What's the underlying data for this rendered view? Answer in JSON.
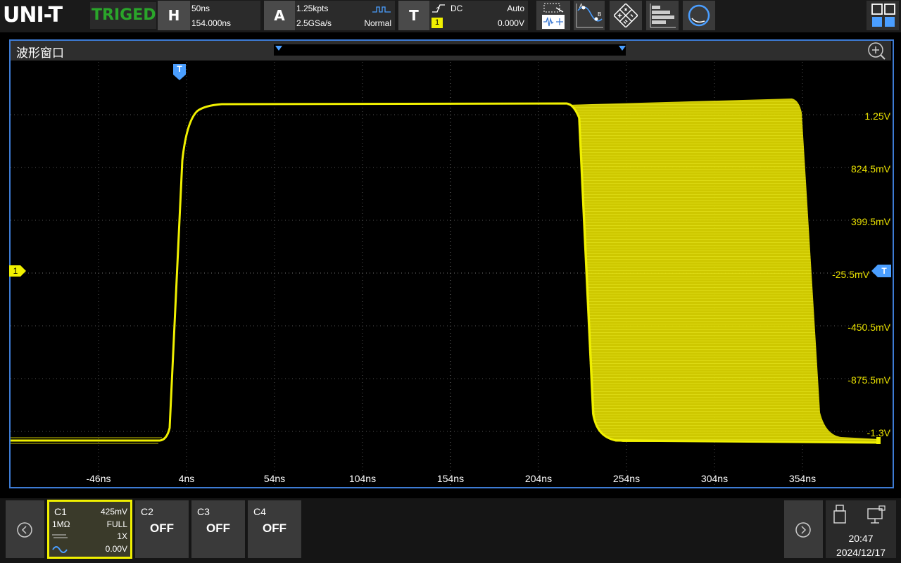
{
  "brand": {
    "logo": "UNI-T",
    "trigger_status": "TRIGED"
  },
  "horizontal": {
    "button": "H",
    "timebase": "50ns",
    "position": "154.000ns"
  },
  "acquire": {
    "button": "A",
    "memory_depth": "1.25kpts",
    "sample_rate": "2.5GSa/s",
    "mode": "Normal"
  },
  "trigger": {
    "button": "T",
    "coupling": "DC",
    "sweep": "Auto",
    "source": "1",
    "level": "0.000V"
  },
  "toolbar": [
    "cursor-measure-icon",
    "ab-cursor-icon",
    "math-icon",
    "histogram-icon",
    "search-icon"
  ],
  "window": {
    "title": "波形窗口"
  },
  "y_axis_labels": [
    "1.25V",
    "824.5mV",
    "399.5mV",
    "-25.5mV",
    "-450.5mV",
    "-875.5mV",
    "-1.3V"
  ],
  "x_axis_labels": [
    "-46ns",
    "4ns",
    "54ns",
    "104ns",
    "154ns",
    "204ns",
    "254ns",
    "304ns",
    "354ns"
  ],
  "markers": {
    "channel1": "1",
    "trigger_top": "T",
    "trigger_right": "T"
  },
  "channels": [
    {
      "name": "C1",
      "scale": "425mV",
      "impedance": "1MΩ",
      "bandwidth": "FULL",
      "probe": "1X",
      "offset": "0.00V"
    },
    {
      "name": "C2",
      "state": "OFF"
    },
    {
      "name": "C3",
      "state": "OFF"
    },
    {
      "name": "C4",
      "state": "OFF"
    }
  ],
  "status": {
    "time": "20:47",
    "date": "2024/12/17"
  },
  "colors": {
    "ch1": "#f0f000",
    "accent": "#3d7bd4",
    "trig_green": "#2aa52a"
  }
}
